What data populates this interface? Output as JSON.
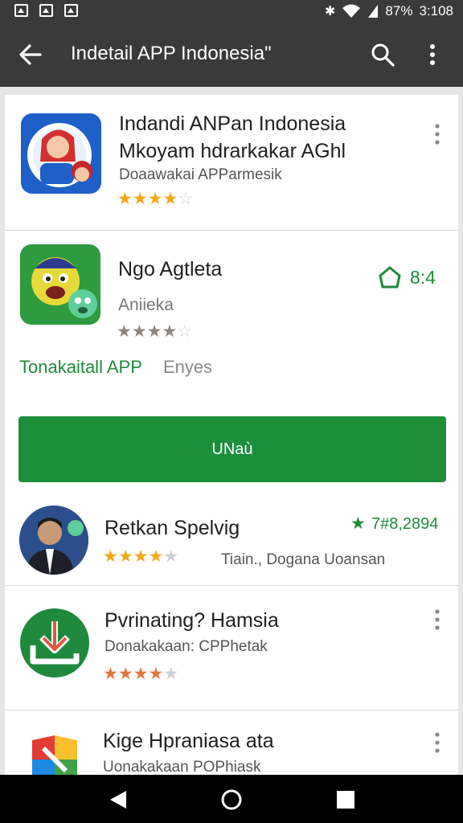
{
  "status_bar": {
    "battery": "87%",
    "time": "3:108"
  },
  "app_bar": {
    "title": "Indetail APP Indonesia\""
  },
  "items": [
    {
      "title_line1": "Indandi ANPan Indonesia",
      "title_line2": "Mkoyam hdrarkakar AGhl",
      "developer": "Doaawakai APParmesik",
      "rating": 3.5
    },
    {
      "title": "Ngo Agtleta",
      "developer": "Aniieka",
      "badge_value": "8:4",
      "rating": 4,
      "tag_primary": "Tonakaitall APP",
      "tag_secondary": "Enyes",
      "install_label": "UNaù"
    },
    {
      "title": "Retkan Spelvig",
      "score": "7#8,2894",
      "meta": "Tiain., Dogana Uoansan",
      "rating": 4
    },
    {
      "title": "Pvrinating? Hamsia",
      "developer": "Donakakaan: CPPhetak",
      "rating": 4
    },
    {
      "title": "Kige Hpraniasa ata",
      "developer": "Uonakakaan POPhiask"
    }
  ],
  "colors": {
    "accent_green": "#1d8f3b",
    "star_gold": "#f2a71c",
    "bar_bg": "#3a3a3a"
  },
  "icons": [
    "back-arrow-icon",
    "search-icon",
    "more-vert-icon",
    "store-badge-icon",
    "star-icon",
    "download-icon",
    "nav-back-icon",
    "nav-home-icon",
    "nav-recents-icon"
  ]
}
